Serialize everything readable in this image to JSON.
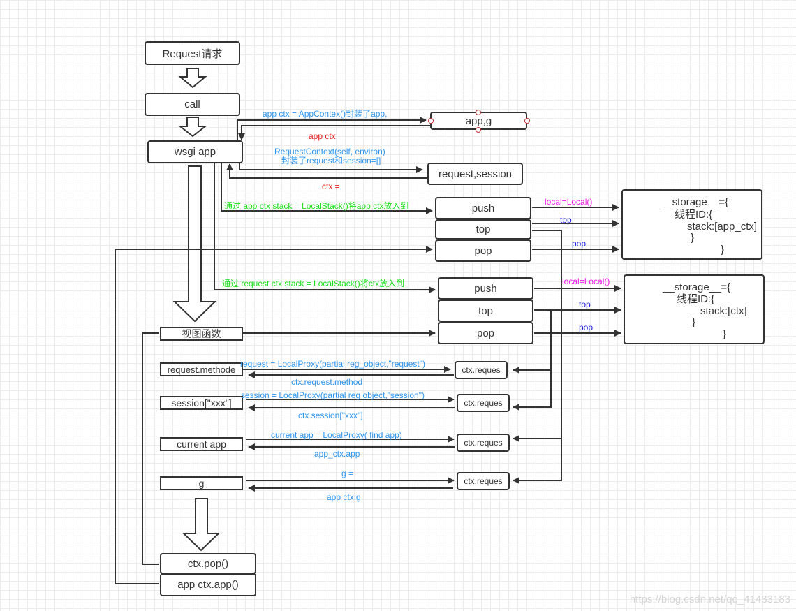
{
  "colors": {
    "stroke": "#333333",
    "blue_label": "#2e95f0",
    "red_label": "#e8191c",
    "green_label": "#19e019",
    "magenta_label": "#f018f0",
    "navy_label": "#1a1ae6"
  },
  "flow": {
    "request": "Request请求",
    "call": "call",
    "wsgi_app": "wsgi  app",
    "view_func": "视图函数",
    "request_method": "request.methode",
    "session_xxx": "session[\"xxx\"]",
    "current_app": "current  app",
    "g": "g",
    "ctx_pop": "ctx.pop()",
    "app_ctx_app": "app  ctx.app()"
  },
  "contexts": {
    "app_g": "app,g",
    "request_session": "request,session"
  },
  "labels": {
    "app_ctx_create": "app  ctx = AppContex()封装了app,",
    "app_ctx_return": "app  ctx",
    "request_context_line1": "RequestContext(self, environ)",
    "request_context_line2": "封装了request和session=[]",
    "ctx_return": "ctx =",
    "app_stack_push": "通过  app  ctx  stack = LocalStack()将app  ctx放入到",
    "req_stack_push": "通过  request  ctx  stack = LocalStack()将ctx放入到",
    "local_1": "local=Local()",
    "top_1": "top",
    "pop_1": "pop",
    "local_2": "local=Local()",
    "top_2": "top",
    "pop_2": "pop",
    "proxy_request": "request = LocalProxy(partial  reg_object,\"request\")",
    "proxy_request_ret": "ctx.request.method",
    "proxy_session": "session = LocalProxy(partial   reg  object,\"session\")",
    "proxy_session_ret": "ctx.session[\"xxx\"]",
    "proxy_current_app": "current  app = LocalProxy(  find  app)",
    "proxy_current_app_ret": "app_ctx.app",
    "proxy_g": "g =",
    "proxy_g_ret": "app  ctx.g"
  },
  "app_stack": {
    "push": "push",
    "top": "top",
    "pop": "pop"
  },
  "req_stack": {
    "push": "push",
    "top": "top",
    "pop": "pop"
  },
  "storage_app": {
    "line1": "__storage__={",
    "line2": "线程ID:{",
    "line3": "stack:[app_ctx]",
    "line4": "}",
    "line5": "}"
  },
  "storage_req": {
    "line1": "__storage__={",
    "line2": "线程ID:{",
    "line3": "stack:[ctx]",
    "line4": "}",
    "line5": "}"
  },
  "proxy_targets": [
    "ctx.reques",
    "ctx.reques",
    "ctx.reques",
    "ctx.reques"
  ],
  "watermark": "https://blog.csdn.net/qq_41433183"
}
